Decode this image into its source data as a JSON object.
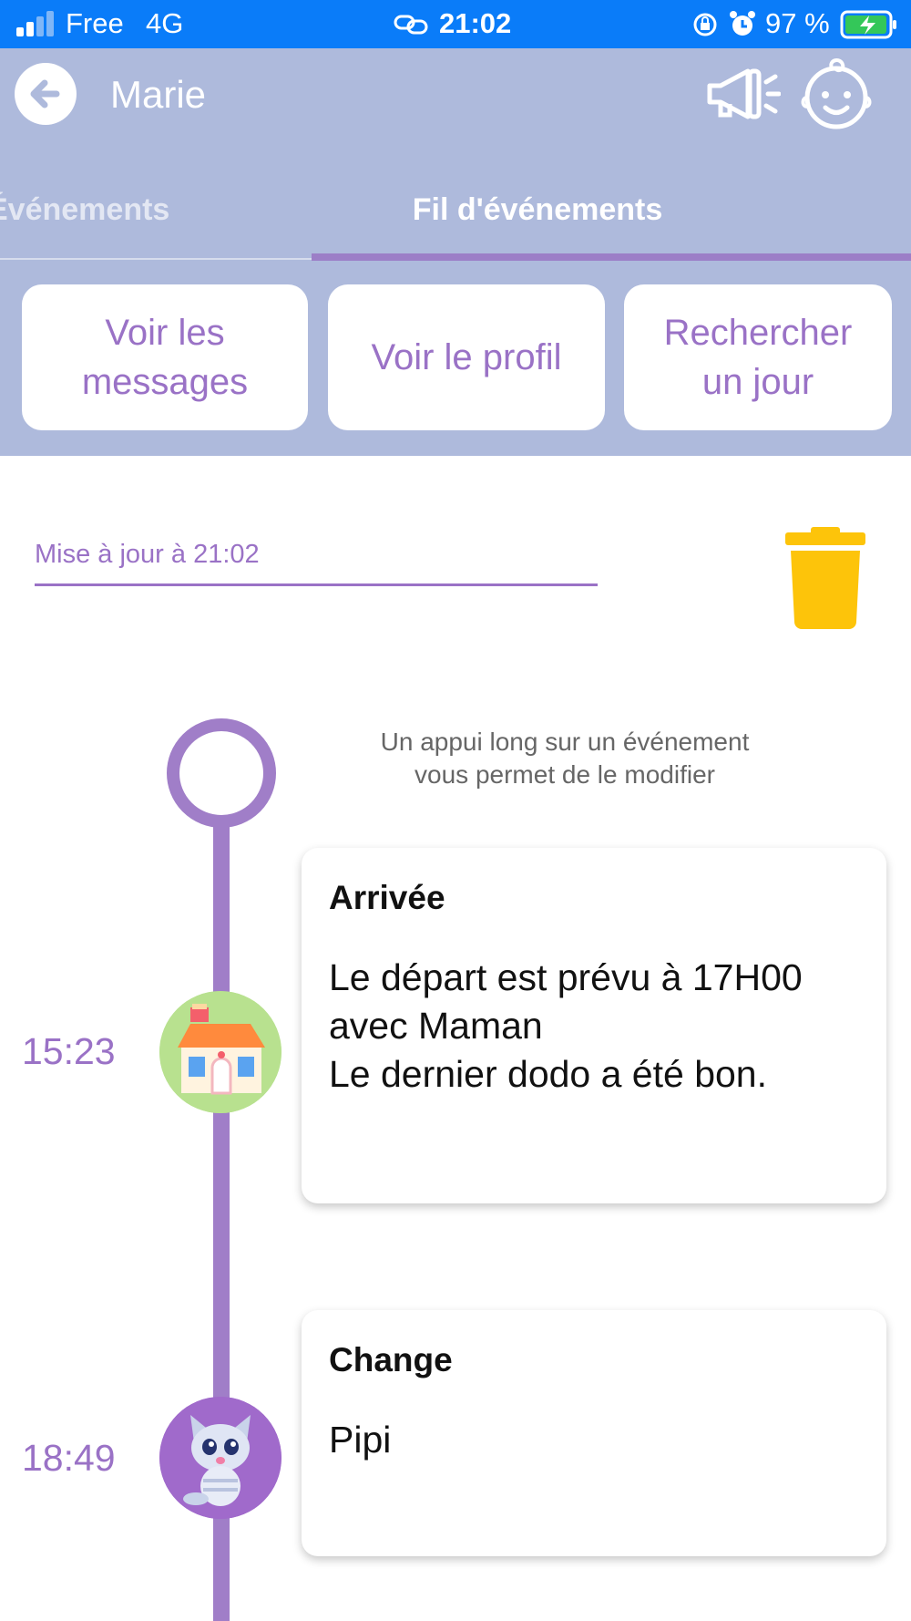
{
  "status_bar": {
    "carrier": "Free",
    "network": "4G",
    "time": "21:02",
    "battery": "97 %",
    "bar_color": "#0a7cf9",
    "icons": [
      "signal-icon",
      "link-icon",
      "orientation-lock-icon",
      "alarm-icon",
      "battery-charging-icon"
    ]
  },
  "header": {
    "name": "Marie",
    "icons": [
      "back-arrow-icon",
      "megaphone-icon",
      "baby-face-icon"
    ]
  },
  "tabs": [
    {
      "label": "Événements",
      "selected": false
    },
    {
      "label": "Fil d'événements",
      "selected": true
    }
  ],
  "actions": [
    {
      "label": "Voir les\nmessages"
    },
    {
      "label": "Voir le profil"
    },
    {
      "label": "Rechercher\nun jour"
    }
  ],
  "feed": {
    "update_label": "Mise à jour à 21:02",
    "hint": "Un appui long sur un événement\nvous permet de le modifier",
    "events": [
      {
        "time": "15:23",
        "title": "Arrivée",
        "body": "Le départ est prévu à 17H00\navec Maman\nLe dernier dodo a été bon.",
        "icon": "house-icon"
      },
      {
        "time": "18:49",
        "title": "Change",
        "body": "Pipi",
        "icon": "kitten-icon"
      }
    ]
  },
  "colors": {
    "header_bg": "#aebadc",
    "accent_purple": "#9a72c6",
    "timeline": "#a07ec8",
    "trash_yellow": "#fdc40a"
  }
}
